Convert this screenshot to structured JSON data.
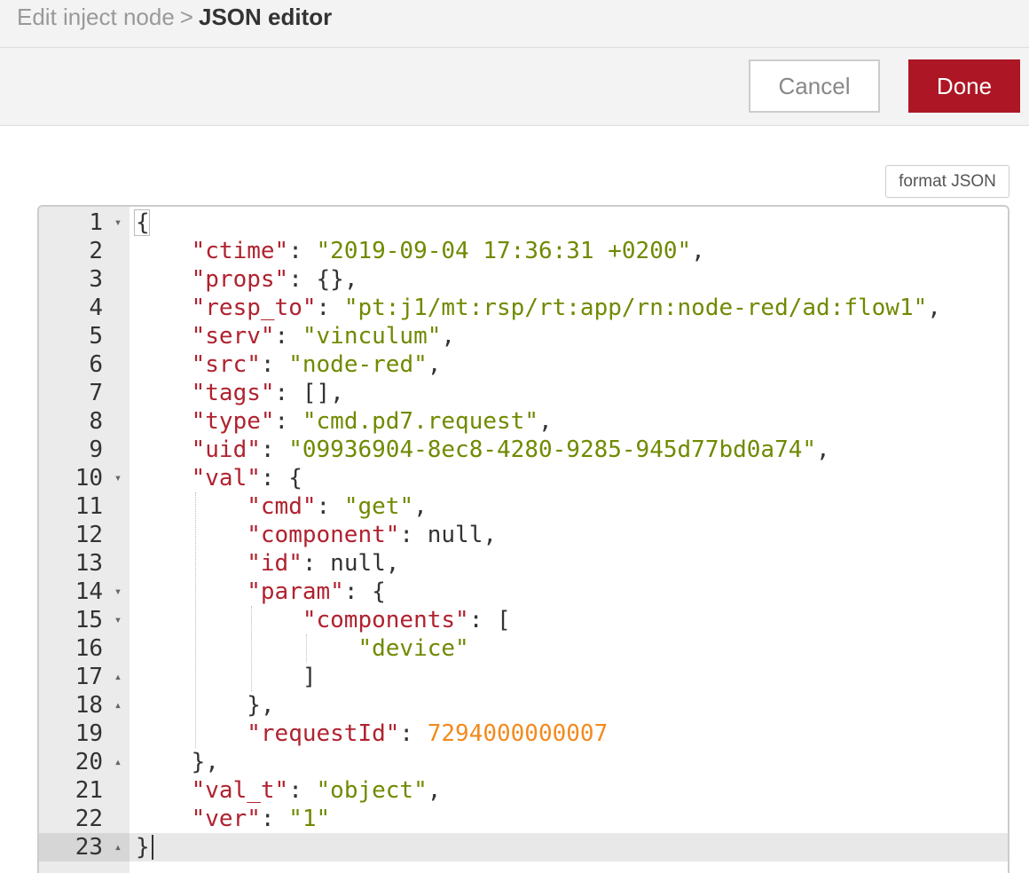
{
  "breadcrumb": {
    "parent": "Edit inject node",
    "separator": ">",
    "current": "JSON editor"
  },
  "toolbar": {
    "cancel_label": "Cancel",
    "done_label": "Done",
    "done_color": "#ad1625"
  },
  "editor": {
    "format_label": "format JSON",
    "fold_open_icon": "caret-down-icon",
    "fold_close_icon": "caret-up-icon",
    "lines": [
      {
        "num": "1",
        "fold": "▾",
        "text": "{"
      },
      {
        "num": "2",
        "fold": "",
        "text": "    \"ctime\": \"2019-09-04 17:36:31 +0200\","
      },
      {
        "num": "3",
        "fold": "",
        "text": "    \"props\": {},"
      },
      {
        "num": "4",
        "fold": "",
        "text": "    \"resp_to\": \"pt:j1/mt:rsp/rt:app/rn:node-red/ad:flow1\","
      },
      {
        "num": "5",
        "fold": "",
        "text": "    \"serv\": \"vinculum\","
      },
      {
        "num": "6",
        "fold": "",
        "text": "    \"src\": \"node-red\","
      },
      {
        "num": "7",
        "fold": "",
        "text": "    \"tags\": [],"
      },
      {
        "num": "8",
        "fold": "",
        "text": "    \"type\": \"cmd.pd7.request\","
      },
      {
        "num": "9",
        "fold": "",
        "text": "    \"uid\": \"09936904-8ec8-4280-9285-945d77bd0a74\","
      },
      {
        "num": "10",
        "fold": "▾",
        "text": "    \"val\": {"
      },
      {
        "num": "11",
        "fold": "",
        "text": "        \"cmd\": \"get\","
      },
      {
        "num": "12",
        "fold": "",
        "text": "        \"component\": null,"
      },
      {
        "num": "13",
        "fold": "",
        "text": "        \"id\": null,"
      },
      {
        "num": "14",
        "fold": "▾",
        "text": "        \"param\": {"
      },
      {
        "num": "15",
        "fold": "▾",
        "text": "            \"components\": ["
      },
      {
        "num": "16",
        "fold": "",
        "text": "                \"device\""
      },
      {
        "num": "17",
        "fold": "▴",
        "text": "            ]"
      },
      {
        "num": "18",
        "fold": "▴",
        "text": "        },"
      },
      {
        "num": "19",
        "fold": "",
        "text": "        \"requestId\": 7294000000007"
      },
      {
        "num": "20",
        "fold": "▴",
        "text": "    },"
      },
      {
        "num": "21",
        "fold": "",
        "text": "    \"val_t\": \"object\","
      },
      {
        "num": "22",
        "fold": "",
        "text": "    \"ver\": \"1\""
      },
      {
        "num": "23",
        "fold": "▴",
        "text": "}"
      }
    ],
    "active_line": 23,
    "colors": {
      "key": "#b0222f",
      "string": "#6f8a00",
      "number": "#f28a1d",
      "punctuation": "#333333"
    }
  }
}
